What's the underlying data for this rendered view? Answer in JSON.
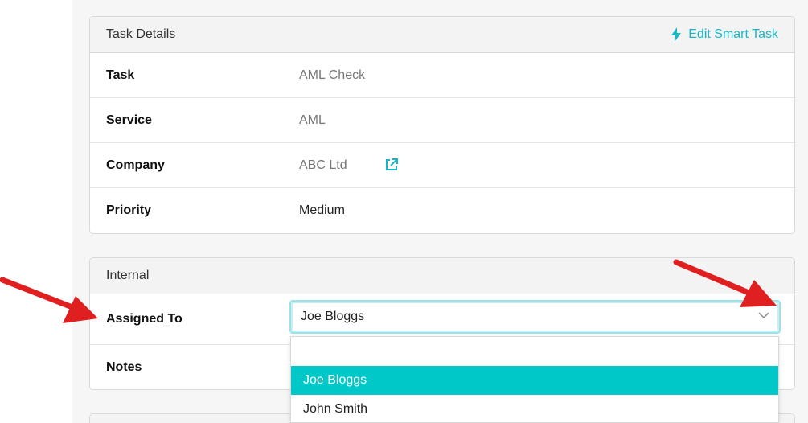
{
  "task_details": {
    "title": "Task Details",
    "edit_label": "Edit Smart Task",
    "rows": [
      {
        "label": "Task",
        "value": "AML Check"
      },
      {
        "label": "Service",
        "value": "AML"
      },
      {
        "label": "Company",
        "value": "ABC Ltd"
      },
      {
        "label": "Priority",
        "value": "Medium"
      }
    ]
  },
  "internal": {
    "title": "Internal",
    "assigned_to_label": "Assigned To",
    "assigned_to_value": "Joe Bloggs",
    "notes_label": "Notes"
  },
  "dropdown": {
    "options": [
      "Joe Bloggs",
      "John Smith"
    ],
    "selected_index": 0
  },
  "colors": {
    "accent": "#14b8c4",
    "highlight": "#00c8c8",
    "annotation_arrow": "#e02020"
  }
}
